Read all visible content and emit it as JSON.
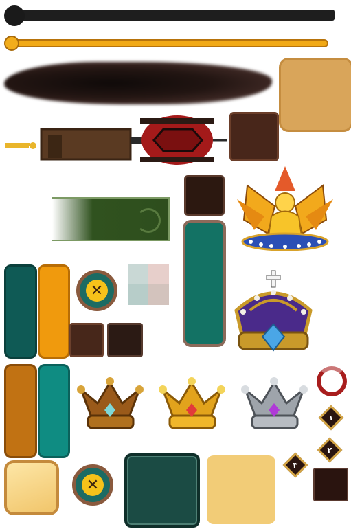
{
  "sliders": {
    "dark": {
      "value": 0
    },
    "gold": {
      "value": 0
    }
  },
  "badges": {
    "d1": "١",
    "d2": "٢",
    "d3": "٣"
  },
  "colors": {
    "teal": "#137264",
    "orange": "#f09a0d",
    "tan": "#d9a55a",
    "brown": "#48261a",
    "gold": "#f1a916",
    "dark_green": "#1b4b44"
  },
  "icons": {
    "close": "close-x-icon",
    "lantern": "lantern-icon",
    "crown_rank": [
      "bronze-crown-icon",
      "gold-crown-icon",
      "silver-crown-icon"
    ],
    "emblem": "golden-winged-emblem-icon",
    "royal_crown": "royal-crown-icon"
  }
}
